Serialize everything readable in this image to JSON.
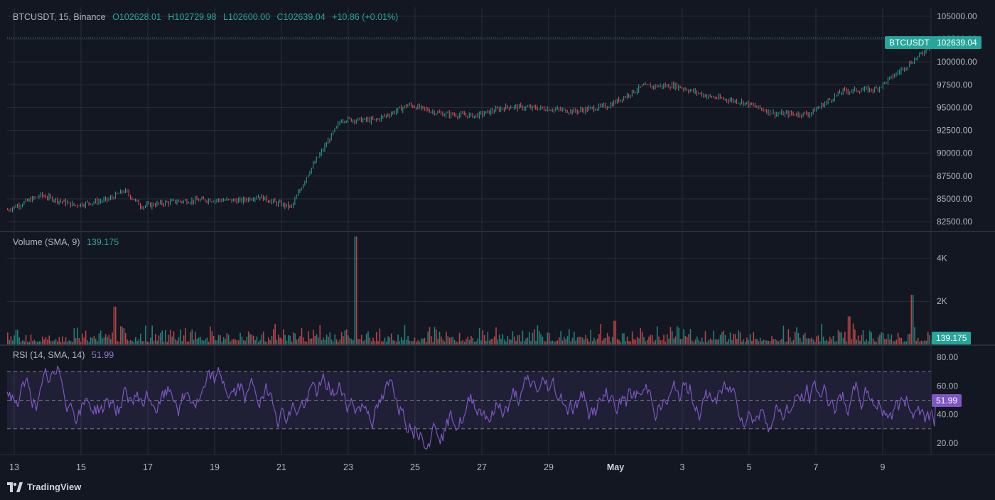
{
  "header": {
    "symbol": "BTCUSDT, 15, Binance",
    "open": "O102628.01",
    "high": "H102729.98",
    "low": "L102600.00",
    "close": "C102639.04",
    "change": "+10.86 (+0.01%)"
  },
  "price_tag": {
    "symbol": "BTCUSDT",
    "value": "102639.04"
  },
  "volume_legend": {
    "name": "Volume (SMA, 9)",
    "value": "139.175"
  },
  "volume_tag": "139.175",
  "rsi_legend": {
    "name": "RSI (14, SMA, 14)",
    "value": "51.99"
  },
  "rsi_tag": "51.99",
  "footer": {
    "brand": "TradingView"
  },
  "colors": {
    "up": "#26a69a",
    "down": "#ef5350",
    "rsi": "#7e57c2",
    "bg": "#131722",
    "grid": "#2a2e39"
  },
  "chart_data": [
    {
      "type": "line",
      "name": "price",
      "x_labels": [
        "13",
        "15",
        "17",
        "19",
        "21",
        "23",
        "25",
        "27",
        "29",
        "May",
        "3",
        "5",
        "7",
        "9"
      ],
      "y_ticks": [
        "105000.00",
        "102500.00",
        "100000.00",
        "97500.00",
        "95000.00",
        "92500.00",
        "90000.00",
        "87500.00",
        "85000.00",
        "82500.00"
      ],
      "ylim": [
        81500,
        106000
      ],
      "x": [
        0,
        1,
        2,
        3,
        3.5,
        4,
        5,
        6,
        7,
        7.5,
        8,
        8.5,
        9,
        10,
        11,
        11.5,
        12,
        13,
        14,
        15,
        16,
        17,
        18,
        19,
        20,
        21,
        22,
        23,
        24,
        25,
        26,
        27,
        27.4,
        27.8
      ],
      "values": [
        83800,
        85400,
        84300,
        84900,
        85900,
        84200,
        84700,
        84900,
        84800,
        85300,
        84600,
        84100,
        87800,
        93700,
        93600,
        94400,
        95300,
        94300,
        94100,
        95100,
        94900,
        94600,
        95200,
        97300,
        97400,
        96200,
        95600,
        94300,
        94300,
        96800,
        97000,
        99800,
        101000,
        102639
      ]
    },
    {
      "type": "bar",
      "name": "volume",
      "y_ticks": [
        "4K",
        "2K"
      ],
      "ylim": [
        0,
        5200
      ],
      "spikes": [
        {
          "x": 10.4,
          "value": 5000
        },
        {
          "x": 27.1,
          "value": 2300
        },
        {
          "x": 3.2,
          "value": 1750
        },
        {
          "x": 18.2,
          "value": 1100
        },
        {
          "x": 25.2,
          "value": 1300
        }
      ],
      "baseline": 120
    },
    {
      "type": "line",
      "name": "rsi",
      "y_ticks": [
        "80.00",
        "60.00",
        "40.00",
        "20.00"
      ],
      "ylim": [
        12,
        88
      ],
      "band": [
        30,
        70
      ],
      "mid": 50,
      "last": 51.99
    }
  ]
}
